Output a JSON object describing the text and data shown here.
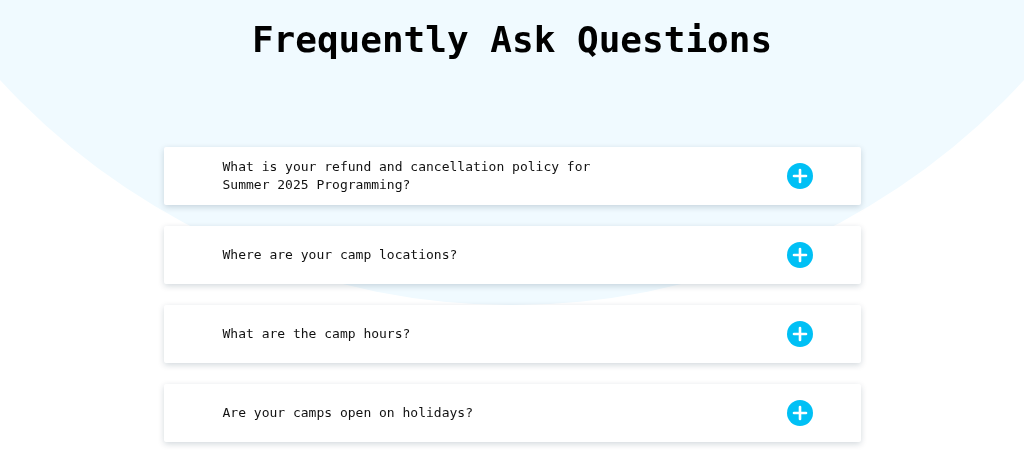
{
  "title": "Frequently Ask Questions",
  "faqs": [
    {
      "question": "What is your refund and cancellation policy for\nSummer 2025 Programming?",
      "expanded": false
    },
    {
      "question": "Where are your camp locations?",
      "expanded": false
    },
    {
      "question": "What are the camp hours?",
      "expanded": false
    },
    {
      "question": "Are your camps open on holidays?",
      "expanded": false
    }
  ]
}
